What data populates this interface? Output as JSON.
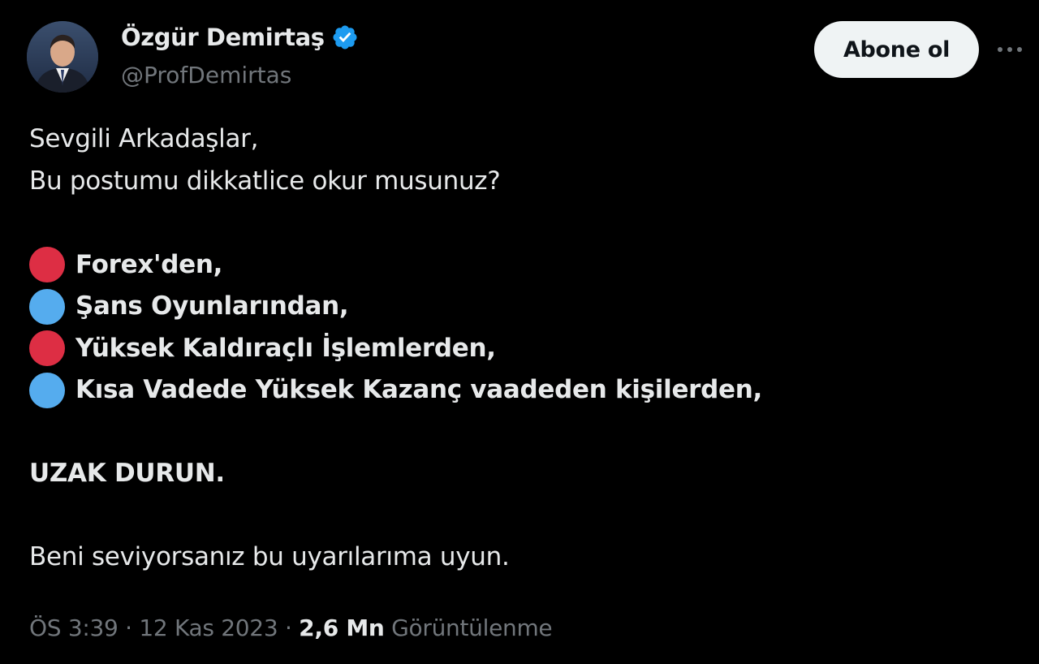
{
  "author": {
    "name": "Özgür Demirtaş",
    "handle": "@ProfDemirtas",
    "verified_color": "#1d9bf0"
  },
  "actions": {
    "follow_label": "Abone ol",
    "more_icon": "more-horizontal-icon"
  },
  "tweet": {
    "greeting": "Sevgili Arkadaşlar,",
    "question": "Bu postumu dikkatlice okur musunuz?",
    "bullets": [
      {
        "text": "Forex'den,",
        "color": "#dd2e44"
      },
      {
        "text": "Şans Oyunlarından,",
        "color": "#55acee"
      },
      {
        "text": "Yüksek Kaldıraçlı İşlemlerden,",
        "color": "#dd2e44"
      },
      {
        "text": "Kısa Vadede Yüksek Kazanç vaadeden kişilerden,",
        "color": "#55acee"
      }
    ],
    "warning": "UZAK DURUN.",
    "closing": "Beni seviyorsanız bu uyarılarıma uyun."
  },
  "meta": {
    "time": "ÖS 3:39",
    "separator": "·",
    "date": "12 Kas 2023",
    "views_count": "2,6 Mn",
    "views_label": "Görüntülenme"
  }
}
